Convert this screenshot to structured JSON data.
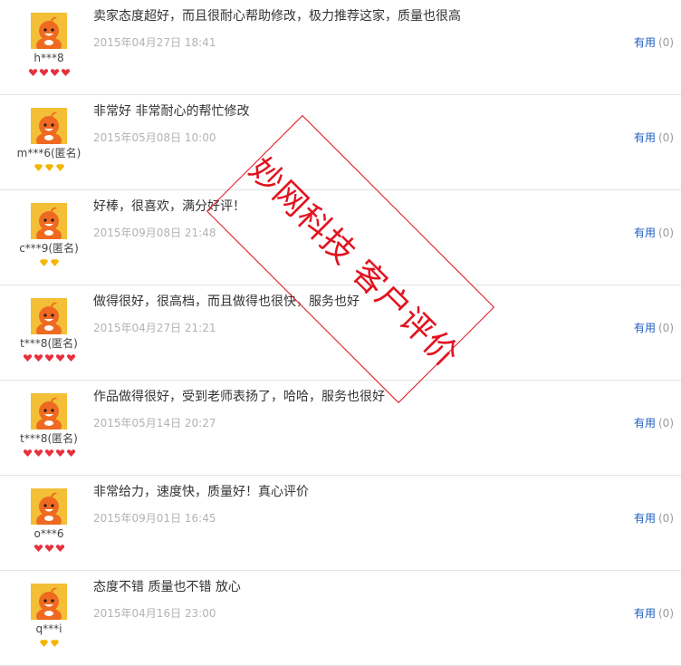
{
  "colors": {
    "avatar_bg": "#f2bf37",
    "avatar_figure": "#ef6a21",
    "link": "#1c5dbf",
    "stamp": "#e2131f",
    "heart_rank": "#e8303c",
    "diamond_rank": "#f5b400"
  },
  "watermark": {
    "text": "妙网科技 客户评价"
  },
  "reviews": [
    {
      "username": "h***8",
      "rank_icon": "heart-icon",
      "rank_count": 4,
      "text": "卖家态度超好，而且很耐心帮助修改，极力推荐这家，质量也很高",
      "time": "2015年04月27日 18:41",
      "useful_label": "有用",
      "useful_count": "(0)"
    },
    {
      "username": "m***6(匿名)",
      "rank_icon": "diamond-icon",
      "rank_count": 3,
      "text": "非常好 非常耐心的帮忙修改",
      "time": "2015年05月08日 10:00",
      "useful_label": "有用",
      "useful_count": "(0)"
    },
    {
      "username": "c***9(匿名)",
      "rank_icon": "diamond-icon",
      "rank_count": 2,
      "text": "好棒，很喜欢，满分好评！",
      "time": "2015年09月08日 21:48",
      "useful_label": "有用",
      "useful_count": "(0)"
    },
    {
      "username": "t***8(匿名)",
      "rank_icon": "heart-icon",
      "rank_count": 5,
      "text": "做得很好，很高档，而且做得也很快，服务也好",
      "time": "2015年04月27日 21:21",
      "useful_label": "有用",
      "useful_count": "(0)"
    },
    {
      "username": "t***8(匿名)",
      "rank_icon": "heart-icon",
      "rank_count": 5,
      "text": "作品做得很好，受到老师表扬了，哈哈，服务也很好",
      "time": "2015年05月14日 20:27",
      "useful_label": "有用",
      "useful_count": "(0)"
    },
    {
      "username": "o***6",
      "rank_icon": "heart-icon",
      "rank_count": 3,
      "text": "非常给力，速度快，质量好！真心评价",
      "time": "2015年09月01日 16:45",
      "useful_label": "有用",
      "useful_count": "(0)"
    },
    {
      "username": "q***i",
      "rank_icon": "diamond-icon",
      "rank_count": 2,
      "text": "态度不错 质量也不错 放心",
      "time": "2015年04月16日 23:00",
      "useful_label": "有用",
      "useful_count": "(0)"
    }
  ]
}
